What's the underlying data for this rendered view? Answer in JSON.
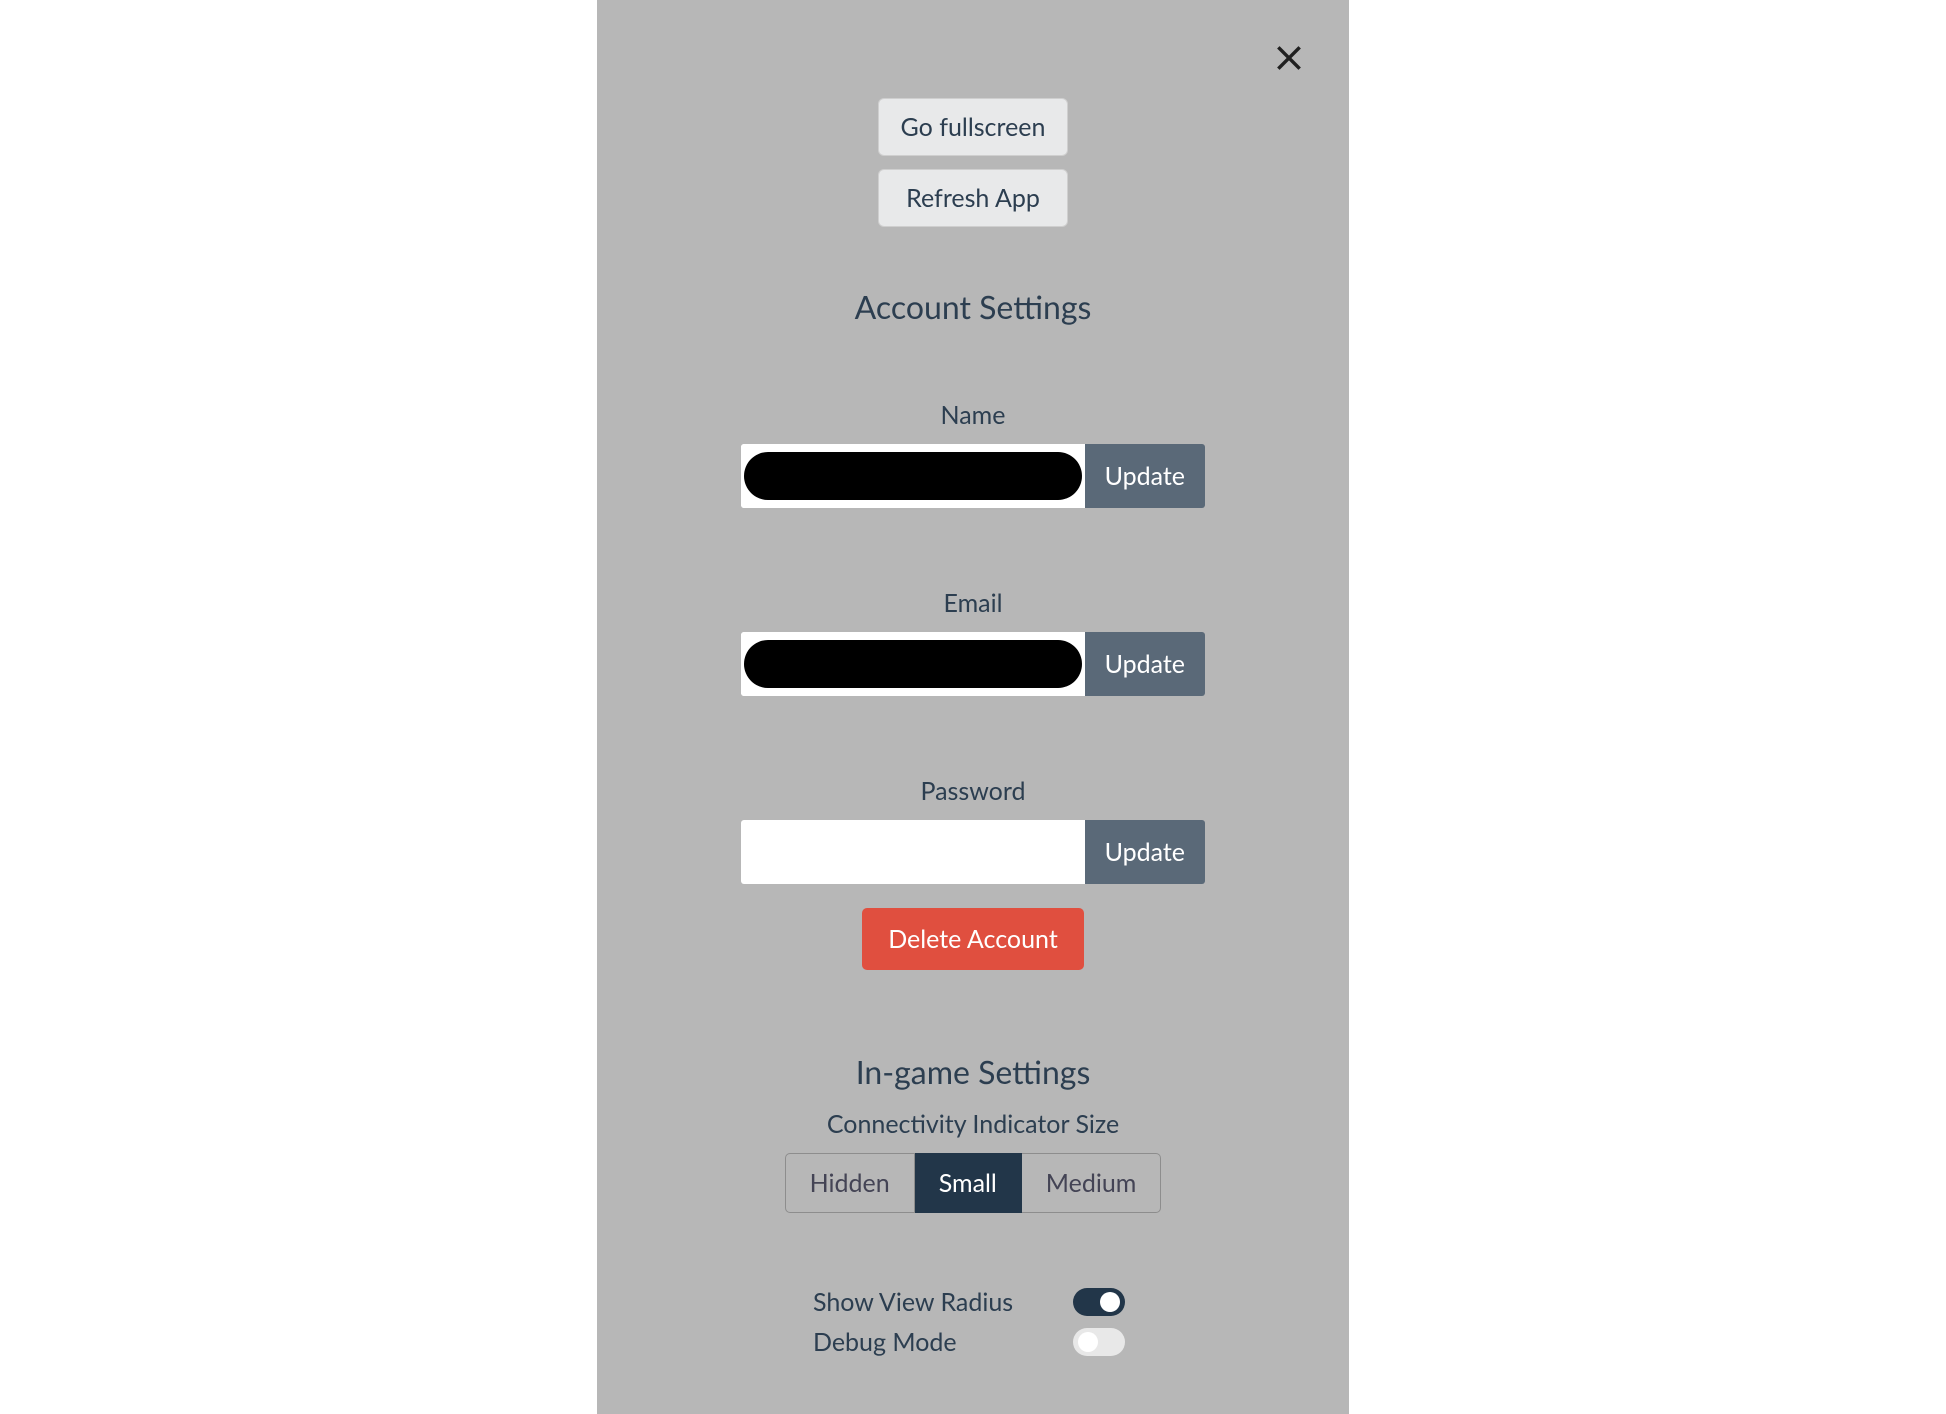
{
  "modal": {
    "close_icon_name": "close-icon",
    "go_fullscreen_label": "Go fullscreen",
    "refresh_app_label": "Refresh App"
  },
  "account": {
    "section_title": "Account Settings",
    "name_label": "Name",
    "name_value": "",
    "name_update_label": "Update",
    "email_label": "Email",
    "email_value": "",
    "email_update_label": "Update",
    "password_label": "Password",
    "password_value": "",
    "password_update_label": "Update",
    "delete_account_label": "Delete Account"
  },
  "ingame": {
    "section_title": "In-game Settings",
    "connectivity_label": "Connectivity Indicator Size",
    "connectivity_options": [
      "Hidden",
      "Small",
      "Medium"
    ],
    "connectivity_selected": "Small",
    "show_view_radius_label": "Show View Radius",
    "show_view_radius_on": true,
    "debug_mode_label": "Debug Mode",
    "debug_mode_on": false
  },
  "colors": {
    "panel_bg": "#b7b7b7",
    "text": "#2c3e50",
    "update_btn": "#5a6978",
    "delete_btn": "#e04f3f",
    "selected_seg": "#223649"
  }
}
